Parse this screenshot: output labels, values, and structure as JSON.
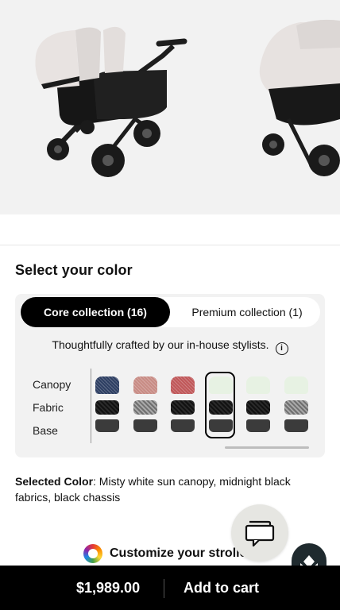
{
  "section_title": "Select your color",
  "tabs": [
    {
      "label": "Core collection (16)",
      "active": true
    },
    {
      "label": "Premium collection (1)",
      "active": false
    }
  ],
  "note": "Thoughtfully crafted by our in-house stylists.",
  "row_labels": {
    "canopy": "Canopy",
    "fabric": "Fabric",
    "base": "Base"
  },
  "swatches": [
    {
      "canopy": "#2e3f63",
      "fabric": "#1b1b1b",
      "base": "#3b3b3b"
    },
    {
      "canopy": "#c88c85",
      "fabric": "#8a8a8a",
      "base": "#3b3b3b"
    },
    {
      "canopy": "#c0585a",
      "fabric": "#1b1b1b",
      "base": "#3b3b3b"
    },
    {
      "canopy": "#e7f2e3",
      "fabric": "#1b1b1b",
      "base": "#3b3b3b",
      "selected": true
    },
    {
      "canopy": "#e7f2e3",
      "fabric": "#1b1b1b",
      "base": "#3b3b3b"
    },
    {
      "canopy": "#e7f2e3",
      "fabric": "#8a8a8a",
      "base": "#3b3b3b"
    }
  ],
  "selected_color": {
    "label": "Selected Color",
    "value": ": Misty white sun canopy, midnight black fabrics, black chassis"
  },
  "customize_label": "Customize your stroller",
  "price": "$1,989.00",
  "cta_label": "Add to cart",
  "icons": [
    "info-icon",
    "color-wheel-icon",
    "chat-icon",
    "brand-logo-icon"
  ]
}
